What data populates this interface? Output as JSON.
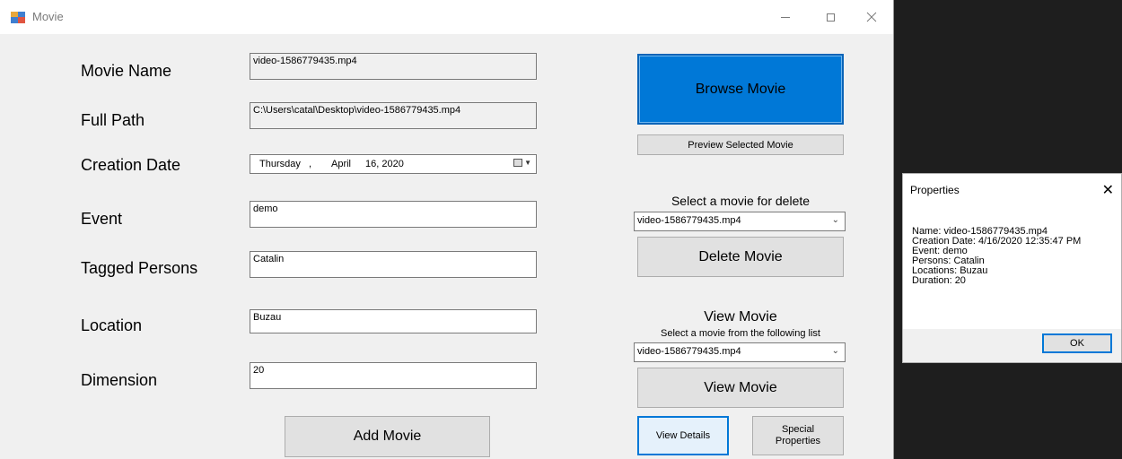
{
  "window": {
    "title": "Movie"
  },
  "form": {
    "movie_name": {
      "label": "Movie Name",
      "value": "video-1586779435.mp4"
    },
    "full_path": {
      "label": "Full Path",
      "value": "C:\\Users\\catal\\Desktop\\video-1586779435.mp4"
    },
    "creation_date": {
      "label": "Creation Date",
      "weekday": "Thursday",
      "sep": ",",
      "month": "April",
      "day_year": "16, 2020"
    },
    "event": {
      "label": "Event",
      "value": "demo"
    },
    "tagged_persons": {
      "label": "Tagged Persons",
      "value": "Catalin"
    },
    "location": {
      "label": "Location",
      "value": "Buzau"
    },
    "dimension": {
      "label": "Dimension",
      "value": "20"
    },
    "add_button": "Add Movie"
  },
  "right": {
    "browse_button": "Browse Movie",
    "preview_button": "Preview Selected Movie",
    "delete_caption": "Select a movie for delete",
    "delete_combo_value": "video-1586779435.mp4",
    "delete_button": "Delete Movie",
    "view_title": "View Movie",
    "view_caption": "Select a movie from the following list",
    "view_combo_value": "video-1586779435.mp4",
    "view_button": "View Movie",
    "details_button": "View Details",
    "special_button_line1": "Special",
    "special_button_line2": "Properties"
  },
  "dialog": {
    "title": "Properties",
    "lines": [
      "Name: video-1586779435.mp4",
      "Creation Date: 4/16/2020 12:35:47 PM",
      "Event: demo",
      "Persons: Catalin",
      "Locations: Buzau",
      "Duration: 20"
    ],
    "ok": "OK"
  },
  "colors": {
    "accent": "#0078d7",
    "window_bg": "#f0f0f0",
    "desktop_bg": "#1e1e1e"
  }
}
